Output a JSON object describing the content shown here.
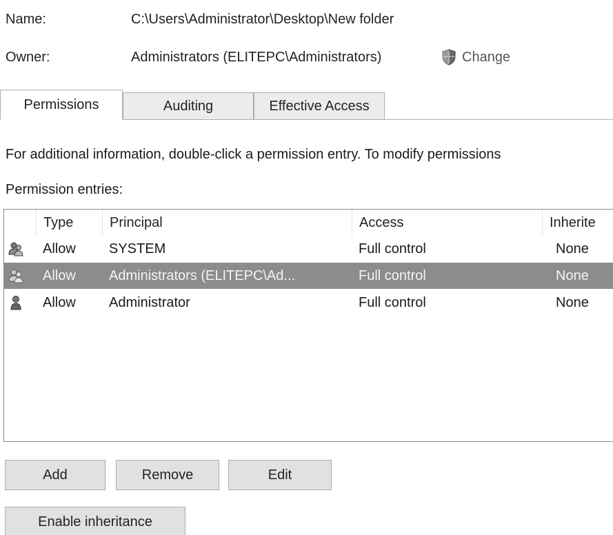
{
  "header": {
    "name_label": "Name:",
    "name_value": "C:\\Users\\Administrator\\Desktop\\New folder",
    "owner_label": "Owner:",
    "owner_value": "Administrators (ELITEPC\\Administrators)",
    "change_label": "Change"
  },
  "tabs": [
    {
      "label": "Permissions"
    },
    {
      "label": "Auditing"
    },
    {
      "label": "Effective Access"
    }
  ],
  "info_text": "For additional information, double-click a permission entry. To modify permissions",
  "entries_label": "Permission entries:",
  "table": {
    "columns": [
      "Type",
      "Principal",
      "Access",
      "Inherite"
    ],
    "rows": [
      {
        "icon": "group-users-icon",
        "type": "Allow",
        "principal": "SYSTEM",
        "access": "Full control",
        "inherited": "None"
      },
      {
        "icon": "group-users-icon",
        "type": "Allow",
        "principal": "Administrators (ELITEPC\\Ad...",
        "access": "Full control",
        "inherited": "None"
      },
      {
        "icon": "user-icon",
        "type": "Allow",
        "principal": "Administrator",
        "access": "Full control",
        "inherited": "None"
      }
    ]
  },
  "buttons": {
    "add": "Add",
    "remove": "Remove",
    "edit": "Edit",
    "enable_inheritance": "Enable inheritance"
  },
  "colors": {
    "selected_row": "#8c8c8c",
    "button_face": "#e1e1e1",
    "border": "#adadad"
  }
}
